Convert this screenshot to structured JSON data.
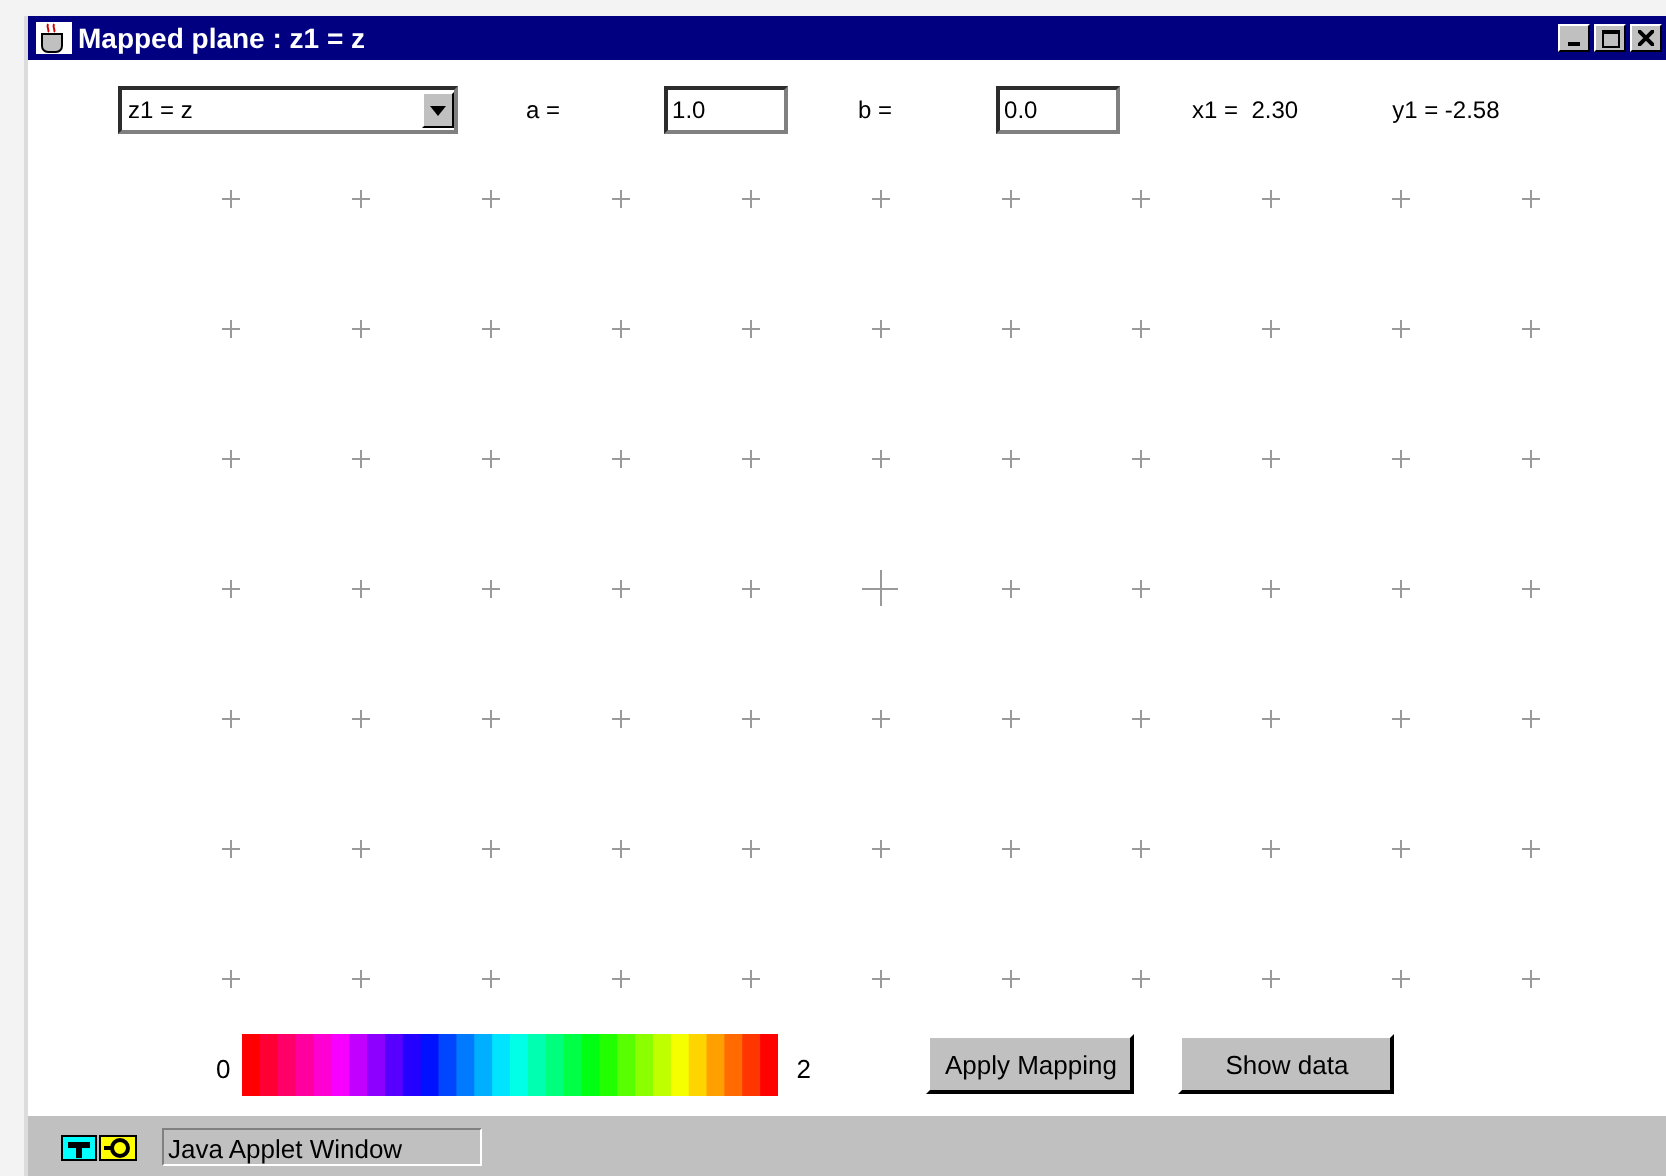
{
  "window": {
    "title": "Mapped plane : z1 = z"
  },
  "controls": {
    "mapping_select": "z1 = z",
    "a_label": "a =",
    "a_value": "1.0",
    "b_label": "b =",
    "b_value": "0.0",
    "x1": "x1 =  2.30",
    "y1": "y1 = -2.58"
  },
  "colorbar": {
    "min_label": "0",
    "max_label": "2"
  },
  "buttons": [
    "Apply Mapping",
    "Show data"
  ],
  "status_bar": {
    "text": "Java Applet Window"
  }
}
